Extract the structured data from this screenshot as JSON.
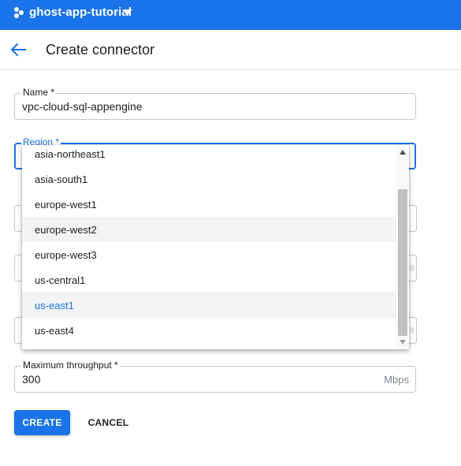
{
  "topbar": {
    "project_name": "ghost-app-tutorial",
    "icon": "project-dots-icon",
    "dropdown_icon": "caret-down-icon",
    "color": "#1a73e8"
  },
  "header": {
    "title": "Create connector",
    "back_icon": "arrow-back-icon"
  },
  "form": {
    "name": {
      "label": "Name *",
      "value": "vpc-cloud-sql-appengine"
    },
    "region": {
      "label": "Region *",
      "value": ""
    },
    "max_throughput": {
      "label": "Maximum throughput *",
      "value": "300",
      "unit": "Mbps"
    }
  },
  "region_dropdown": {
    "options": [
      {
        "label": "asia-northeast1",
        "state": "normal"
      },
      {
        "label": "asia-south1",
        "state": "normal"
      },
      {
        "label": "europe-west1",
        "state": "normal"
      },
      {
        "label": "europe-west2",
        "state": "hover"
      },
      {
        "label": "europe-west3",
        "state": "normal"
      },
      {
        "label": "us-central1",
        "state": "normal"
      },
      {
        "label": "us-east1",
        "state": "selected"
      },
      {
        "label": "us-east4",
        "state": "normal"
      }
    ],
    "scroll_position": 0.55
  },
  "actions": {
    "create_label": "CREATE",
    "cancel_label": "CANCEL"
  }
}
